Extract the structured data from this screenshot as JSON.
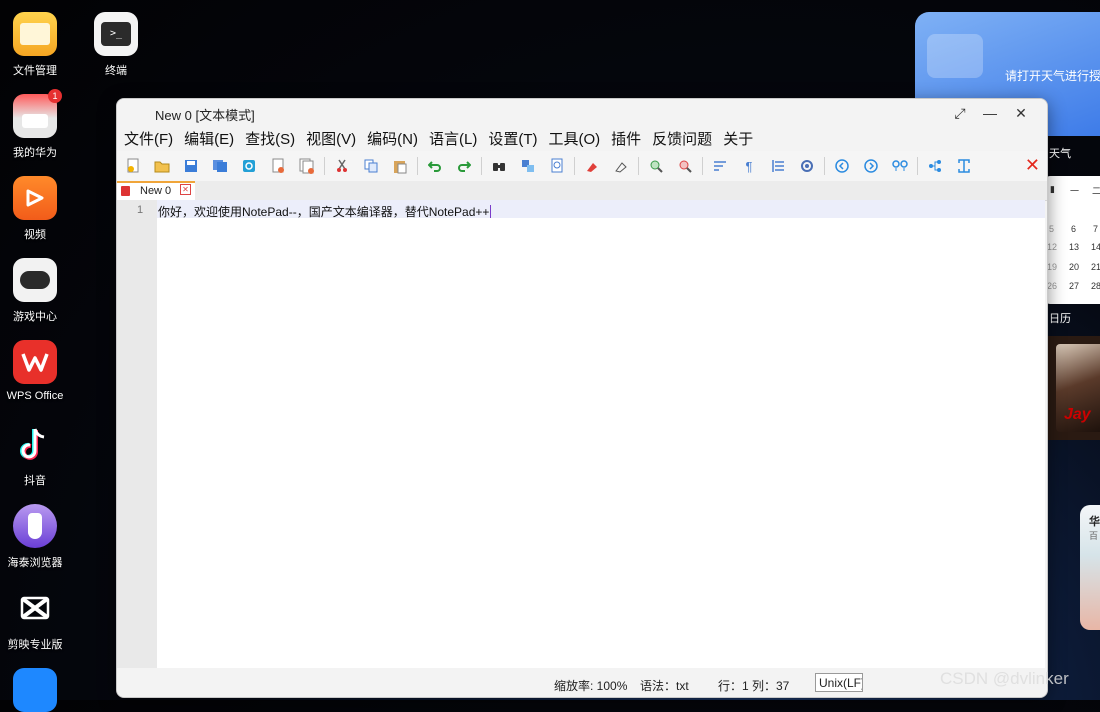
{
  "desktop": {
    "icons": [
      {
        "label": "文件管理"
      },
      {
        "label": "终端"
      },
      {
        "label": "我的华为",
        "badge": "1"
      },
      {
        "label": "视频"
      },
      {
        "label": "游戏中心"
      },
      {
        "label": "WPS Office"
      },
      {
        "label": "抖音"
      },
      {
        "label": "海泰浏览器"
      },
      {
        "label": "剪映专业版"
      }
    ],
    "widgets": {
      "weather_prompt": "请打开天气进行授",
      "weather_label": "天气",
      "calendar_label": "日历",
      "calendar_header": [
        "一",
        "二"
      ],
      "calendar_rows": [
        [
          "5",
          "6",
          "7"
        ],
        [
          "12",
          "13",
          "14"
        ],
        [
          "19",
          "20",
          "21"
        ],
        [
          "26",
          "27",
          "28"
        ]
      ],
      "photo_text": [
        "华",
        "百"
      ]
    },
    "watermark": "CSDN @dvlinker"
  },
  "window": {
    "title": "New 0 [文本模式]",
    "menu": [
      "文件(F)",
      "编辑(E)",
      "查找(S)",
      "视图(V)",
      "编码(N)",
      "语言(L)",
      "设置(T)",
      "工具(O)",
      "插件",
      "反馈问题",
      "关于"
    ],
    "tab": {
      "name": "New 0"
    },
    "editor": {
      "line_number": "1",
      "line_text": "你好，欢迎使用NotePad--，国产文本编译器，替代NotePad++"
    },
    "status": {
      "zoom": "缩放率: 100%",
      "syntax": "语法：txt",
      "position": "行：1 列：37",
      "eol": "Unix(LF)"
    }
  }
}
